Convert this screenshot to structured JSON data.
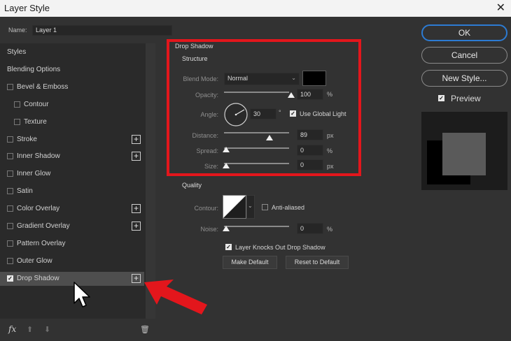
{
  "window": {
    "title": "Layer Style",
    "close_glyph": "✕"
  },
  "name_row": {
    "label": "Name:",
    "value": "Layer 1"
  },
  "left_panel": {
    "items": [
      {
        "label": "Styles",
        "checkbox": false,
        "checked": false,
        "plus": false,
        "indent": 0
      },
      {
        "label": "Blending Options",
        "checkbox": false,
        "checked": false,
        "plus": false,
        "indent": 0
      },
      {
        "label": "Bevel & Emboss",
        "checkbox": true,
        "checked": false,
        "plus": false,
        "indent": 0
      },
      {
        "label": "Contour",
        "checkbox": true,
        "checked": false,
        "plus": false,
        "indent": 1
      },
      {
        "label": "Texture",
        "checkbox": true,
        "checked": false,
        "plus": false,
        "indent": 1
      },
      {
        "label": "Stroke",
        "checkbox": true,
        "checked": false,
        "plus": true,
        "indent": 0
      },
      {
        "label": "Inner Shadow",
        "checkbox": true,
        "checked": false,
        "plus": true,
        "indent": 0
      },
      {
        "label": "Inner Glow",
        "checkbox": true,
        "checked": false,
        "plus": false,
        "indent": 0
      },
      {
        "label": "Satin",
        "checkbox": true,
        "checked": false,
        "plus": false,
        "indent": 0
      },
      {
        "label": "Color Overlay",
        "checkbox": true,
        "checked": false,
        "plus": true,
        "indent": 0
      },
      {
        "label": "Gradient Overlay",
        "checkbox": true,
        "checked": false,
        "plus": true,
        "indent": 0
      },
      {
        "label": "Pattern Overlay",
        "checkbox": true,
        "checked": false,
        "plus": false,
        "indent": 0
      },
      {
        "label": "Outer Glow",
        "checkbox": true,
        "checked": false,
        "plus": false,
        "indent": 0
      },
      {
        "label": "Drop Shadow",
        "checkbox": true,
        "checked": true,
        "plus": true,
        "indent": 0,
        "selected": true
      }
    ],
    "bottom_icons": {
      "fx": "fx",
      "up": "⬆",
      "down": "⬇",
      "trash": "🗑"
    }
  },
  "drop_shadow": {
    "title": "Drop Shadow",
    "structure_title": "Structure",
    "blend_mode": {
      "label": "Blend Mode:",
      "value": "Normal",
      "swatch_color": "#000000"
    },
    "opacity": {
      "label": "Opacity:",
      "value": "100",
      "unit": "%",
      "level": 1.0
    },
    "angle": {
      "label": "Angle:",
      "value": "30",
      "unit": "°",
      "use_global_light": "Use Global Light",
      "global_checked": true
    },
    "distance": {
      "label": "Distance:",
      "value": "89",
      "unit": "px",
      "level": 0.67
    },
    "spread": {
      "label": "Spread:",
      "value": "0",
      "unit": "%",
      "level": 0
    },
    "size": {
      "label": "Size:",
      "value": "0",
      "unit": "px",
      "level": 0
    },
    "quality_title": "Quality",
    "contour": {
      "label": "Contour:",
      "anti_aliased": "Anti-aliased",
      "anti_checked": false
    },
    "noise": {
      "label": "Noise:",
      "value": "0",
      "unit": "%",
      "level": 0
    },
    "knocks_out": {
      "label": "Layer Knocks Out Drop Shadow",
      "checked": true
    },
    "make_default": "Make Default",
    "reset_default": "Reset to Default"
  },
  "buttons": {
    "ok": "OK",
    "cancel": "Cancel",
    "new_style": "New Style..."
  },
  "preview": {
    "label": "Preview",
    "checked": true
  },
  "colors": {
    "highlight": "#e3161c",
    "ok_border": "#2c7bd3",
    "arrow": "#e3161c"
  }
}
